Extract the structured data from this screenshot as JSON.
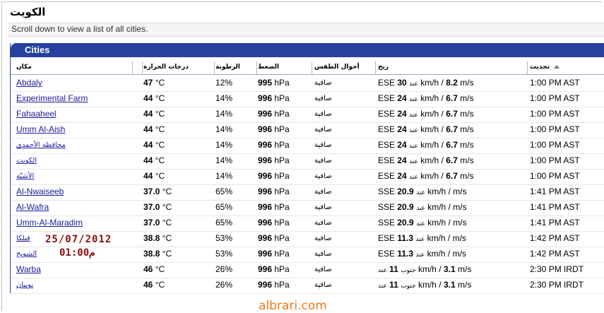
{
  "page": {
    "title": "الكويت",
    "subtitle": "Scroll down to view a list of all cities."
  },
  "panel": {
    "title": "Cities",
    "columns": {
      "place": "مكان",
      "temp": "درجات الحرارة",
      "humidity": "الرطوبة",
      "pressure": "الضغط",
      "conditions": "أحوال الطقس",
      "wind": "ريح",
      "updated": "تحديث"
    }
  },
  "rows": [
    {
      "city": "Abdaly",
      "temp": "47",
      "temp_unit": "°C",
      "hum": "12%",
      "press": "995",
      "press_unit": "hPa",
      "cond": "صافية",
      "dir": "ESE",
      "speed": "30",
      "at": "عند",
      "kmh": "km/h /",
      "ms": "8.2",
      "ms_unit": "m/s",
      "time": "1:00 PM AST"
    },
    {
      "city": "Experimental Farm",
      "temp": "44",
      "temp_unit": "°C",
      "hum": "14%",
      "press": "996",
      "press_unit": "hPa",
      "cond": "صافية",
      "dir": "ESE",
      "speed": "24",
      "at": "عند",
      "kmh": "km/h /",
      "ms": "6.7",
      "ms_unit": "m/s",
      "time": "1:00 PM AST"
    },
    {
      "city": "Fahaaheel",
      "temp": "44",
      "temp_unit": "°C",
      "hum": "14%",
      "press": "996",
      "press_unit": "hPa",
      "cond": "صافية",
      "dir": "ESE",
      "speed": "24",
      "at": "عند",
      "kmh": "km/h /",
      "ms": "6.7",
      "ms_unit": "m/s",
      "time": "1:00 PM AST"
    },
    {
      "city": "Umm Al-Aish",
      "temp": "44",
      "temp_unit": "°C",
      "hum": "14%",
      "press": "996",
      "press_unit": "hPa",
      "cond": "صافية",
      "dir": "ESE",
      "speed": "24",
      "at": "عند",
      "kmh": "km/h /",
      "ms": "6.7",
      "ms_unit": "m/s",
      "time": "1:00 PM AST"
    },
    {
      "city": "محافظة الأحمدي",
      "temp": "44",
      "temp_unit": "°C",
      "hum": "14%",
      "press": "996",
      "press_unit": "hPa",
      "cond": "صافية",
      "dir": "ESE",
      "speed": "24",
      "at": "عند",
      "kmh": "km/h /",
      "ms": "6.7",
      "ms_unit": "m/s",
      "time": "1:00 PM AST",
      "ar": true
    },
    {
      "city": "الكويت",
      "temp": "44",
      "temp_unit": "°C",
      "hum": "14%",
      "press": "996",
      "press_unit": "hPa",
      "cond": "صافية",
      "dir": "ESE",
      "speed": "24",
      "at": "عند",
      "kmh": "km/h /",
      "ms": "6.7",
      "ms_unit": "m/s",
      "time": "1:00 PM AST",
      "ar": true
    },
    {
      "city": "الأشيّة",
      "temp": "44",
      "temp_unit": "°C",
      "hum": "14%",
      "press": "996",
      "press_unit": "hPa",
      "cond": "صافية",
      "dir": "ESE",
      "speed": "24",
      "at": "عند",
      "kmh": "km/h /",
      "ms": "6.7",
      "ms_unit": "m/s",
      "time": "1:00 PM AST",
      "ar": true
    },
    {
      "city": "Al-Nwaiseeb",
      "temp": "37.0",
      "temp_unit": "°C",
      "hum": "65%",
      "press": "996",
      "press_unit": "hPa",
      "cond": "صافية",
      "dir": "SSE",
      "speed": "20.9",
      "at": "عند",
      "kmh": "km/h /",
      "ms": "",
      "ms_unit": "m/s",
      "time": "1:41 PM AST"
    },
    {
      "city": "Al-Wafra",
      "temp": "37.0",
      "temp_unit": "°C",
      "hum": "65%",
      "press": "996",
      "press_unit": "hPa",
      "cond": "صافية",
      "dir": "SSE",
      "speed": "20.9",
      "at": "عند",
      "kmh": "km/h /",
      "ms": "",
      "ms_unit": "m/s",
      "time": "1:41 PM AST"
    },
    {
      "city": "Umm-Al-Maradim",
      "temp": "37.0",
      "temp_unit": "°C",
      "hum": "65%",
      "press": "996",
      "press_unit": "hPa",
      "cond": "صافية",
      "dir": "SSE",
      "speed": "20.9",
      "at": "عند",
      "kmh": "km/h /",
      "ms": "",
      "ms_unit": "m/s",
      "time": "1:41 PM AST"
    },
    {
      "city": "فيلكا",
      "temp": "38.8",
      "temp_unit": "°C",
      "hum": "53%",
      "press": "996",
      "press_unit": "hPa",
      "cond": "صافية",
      "dir": "ESE",
      "speed": "11.3",
      "at": "عند",
      "kmh": "km/h /",
      "ms": "",
      "ms_unit": "m/s",
      "time": "1:42 PM AST",
      "ar": true
    },
    {
      "city": "الشويخ",
      "temp": "38.8",
      "temp_unit": "°C",
      "hum": "53%",
      "press": "996",
      "press_unit": "hPa",
      "cond": "صافية",
      "dir": "ESE",
      "speed": "11.3",
      "at": "عند",
      "kmh": "km/h /",
      "ms": "",
      "ms_unit": "m/s",
      "time": "1:42 PM AST",
      "ar": true
    },
    {
      "city": "Warba",
      "temp": "46",
      "temp_unit": "°C",
      "hum": "26%",
      "press": "996",
      "press_unit": "hPa",
      "cond": "صافية",
      "dir": "جنوب",
      "speed": "11",
      "at": "عند",
      "kmh": "km/h /",
      "ms": "3.1",
      "ms_unit": "m/s",
      "time": "2:30 PM IRDT",
      "dir_ar": true
    },
    {
      "city": "بوبيان",
      "temp": "46",
      "temp_unit": "°C",
      "hum": "26%",
      "press": "996",
      "press_unit": "hPa",
      "cond": "صافية",
      "dir": "جنوب",
      "speed": "11",
      "at": "عند",
      "kmh": "km/h /",
      "ms": "3.1",
      "ms_unit": "m/s",
      "time": "2:30 PM IRDT",
      "ar": true,
      "dir_ar": true
    }
  ],
  "overlay": {
    "date": "25/07/2012",
    "time": "01:00م"
  },
  "watermark": "albrari.com",
  "colors": {
    "panel_header": "#26419e",
    "link": "#1b1b9a",
    "overlay": "#8b0e0e",
    "watermark": "#f07a1a"
  }
}
